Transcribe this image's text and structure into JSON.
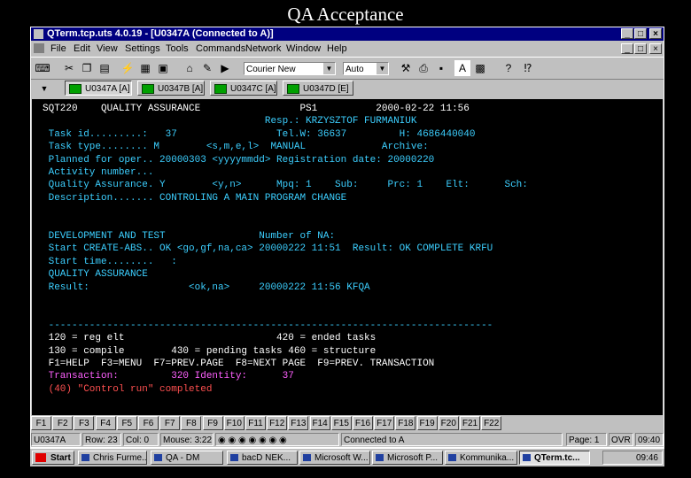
{
  "slide": {
    "title": "QA Acceptance"
  },
  "window": {
    "title": "QTerm.tcp.uts 4.0.19 - [U0347A (Connected to A)]",
    "minimize": "_",
    "restore": "□",
    "close": "×"
  },
  "menu": [
    "File",
    "Edit",
    "View",
    "Settings",
    "Tools",
    "Commands",
    "Network",
    "Window",
    "Help"
  ],
  "toolbar": {
    "font_select": "Courier New",
    "size_select": "Auto",
    "text_button": "A",
    "help_button": "?"
  },
  "sessions": [
    "U0347A [A]",
    "U0347B [A]",
    "U0347C [A]",
    "U0347D [E]"
  ],
  "terminal": {
    "lines": [
      {
        "text": "SQT220    QUALITY ASSURANCE                 PS1          2000-02-22 11:56",
        "color": "#ffffff"
      },
      {
        "text": "                                      Resp.: KRZYSZTOF FURMANIUK",
        "color": "#3ccfff"
      },
      {
        "text": " Task id.........:   37                 Tel.W: 36637         H: 4686440040",
        "color": "#3ccfff"
      },
      {
        "text": " Task type........ M        <s,m,e,l>  MANUAL             Archive:",
        "color": "#3ccfff"
      },
      {
        "text": " Planned for oper.. 20000303 <yyyymmdd> Registration date: 20000220",
        "color": "#3ccfff"
      },
      {
        "text": " Activity number...",
        "color": "#3ccfff"
      },
      {
        "text": " Quality Assurance. Y        <y,n>      Mpq: 1    Sub:     Prc: 1    Elt:      Sch:",
        "color": "#3ccfff"
      },
      {
        "text": " Description....... CONTROLING A MAIN PROGRAM CHANGE",
        "color": "#3ccfff"
      },
      {
        "text": "",
        "color": "#3ccfff"
      },
      {
        "text": "",
        "color": "#3ccfff"
      },
      {
        "text": " DEVELOPMENT AND TEST                Number of NA:",
        "color": "#3ccfff"
      },
      {
        "text": " Start CREATE-ABS.. OK <go,gf,na,ca> 20000222 11:51  Result: OK COMPLETE KRFU",
        "color": "#3ccfff"
      },
      {
        "text": " Start time........   :",
        "color": "#3ccfff"
      },
      {
        "text": " QUALITY ASSURANCE",
        "color": "#3ccfff"
      },
      {
        "text": " Result:                 <ok,na>     20000222 11:56 KFQA",
        "color": "#3ccfff"
      },
      {
        "text": "",
        "color": "#3ccfff"
      },
      {
        "text": "",
        "color": "#3ccfff"
      },
      {
        "text": " ----------------------------------------------------------------------------",
        "color": "#3ccfff"
      },
      {
        "text": " 120 = reg elt                          420 = ended tasks",
        "color": "#ffffff"
      },
      {
        "text": " 130 = compile        430 = pending tasks 460 = structure",
        "color": "#ffffff"
      },
      {
        "text": " F1=HELP  F3=MENU  F7=PREV.PAGE  F8=NEXT PAGE  F9=PREV. TRANSACTION",
        "color": "#ffffff"
      },
      {
        "text": " Transaction:         320 Identity:      37",
        "color": "#ff60ff"
      },
      {
        "text": " (40) \"Control run\" completed",
        "color": "#ff5050"
      }
    ]
  },
  "fkeys": [
    "F1",
    "F2",
    "F3",
    "F4",
    "F5",
    "F6",
    "F7",
    "F8",
    "F9",
    "F10",
    "F11",
    "F12",
    "F13",
    "F14",
    "F15",
    "F16",
    "F17",
    "F18",
    "F19",
    "F20",
    "F21",
    "F22"
  ],
  "status": {
    "session": "U0347A",
    "row": "Row: 23",
    "col": "Col: 0",
    "mouse": "Mouse: 3:22",
    "connected": "Connected to A",
    "page": "Page: 1",
    "ovr": "OVR",
    "time": "09:40"
  },
  "taskbar": {
    "start": "Start",
    "items": [
      "Chris Furme...",
      "QA - DM",
      "bacD NEK...",
      "Microsoft W...",
      "Microsoft P...",
      "Kommunika...",
      "QTerm.tc..."
    ],
    "clock": "09:46"
  }
}
